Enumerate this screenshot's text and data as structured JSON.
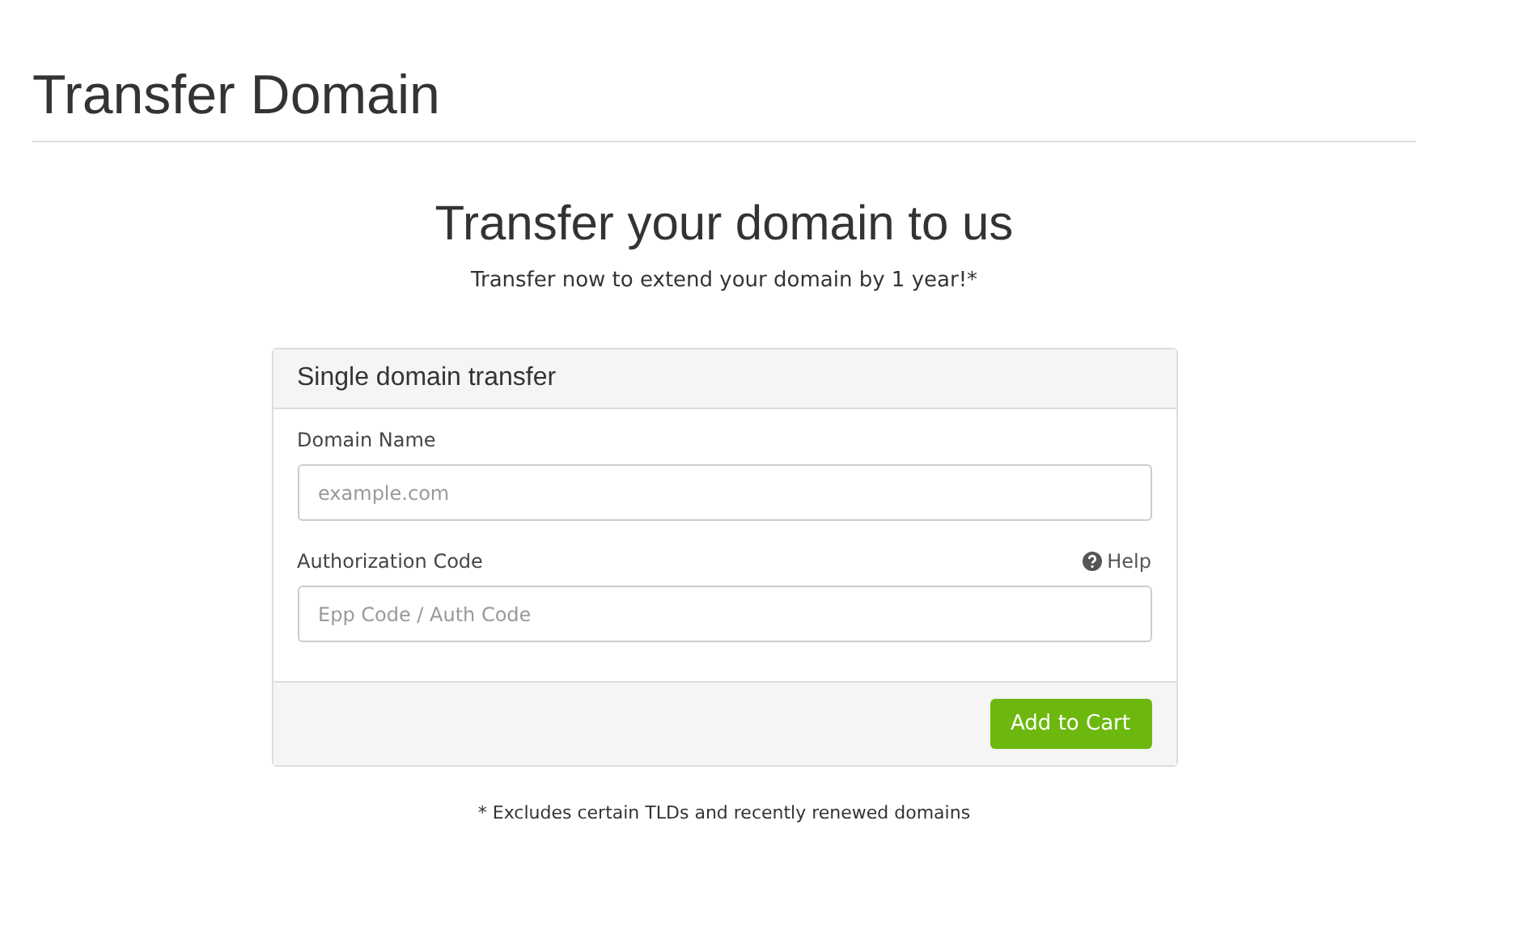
{
  "page_title": "Transfer Domain",
  "heading": "Transfer your domain to us",
  "subheading": "Transfer now to extend your domain by 1 year!*",
  "panel": {
    "title": "Single domain transfer",
    "fields": [
      {
        "label": "Domain Name",
        "placeholder": "example.com"
      },
      {
        "label": "Authorization Code",
        "placeholder": "Epp Code / Auth Code",
        "help": "Help"
      }
    ],
    "button": "Add to Cart"
  },
  "footnote": "* Excludes certain TLDs and recently renewed domains"
}
